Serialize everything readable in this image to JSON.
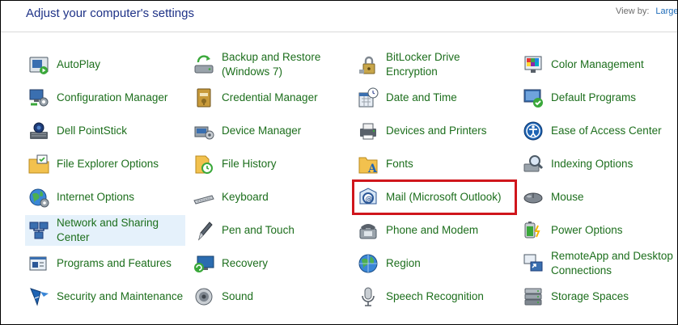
{
  "header": {
    "title": "Adjust your computer's settings",
    "view_by_label": "View by:",
    "view_by_value": "Large i"
  },
  "items": [
    {
      "label": "AutoPlay",
      "icon": "autoplay-icon"
    },
    {
      "label": "Backup and Restore (Windows 7)",
      "icon": "backup-restore-icon"
    },
    {
      "label": "BitLocker Drive Encryption",
      "icon": "bitlocker-icon"
    },
    {
      "label": "Color Management",
      "icon": "color-management-icon"
    },
    {
      "label": "Configuration Manager",
      "icon": "configuration-manager-icon"
    },
    {
      "label": "Credential Manager",
      "icon": "credential-manager-icon"
    },
    {
      "label": "Date and Time",
      "icon": "date-time-icon"
    },
    {
      "label": "Default Programs",
      "icon": "default-programs-icon"
    },
    {
      "label": "Dell PointStick",
      "icon": "dell-pointstick-icon"
    },
    {
      "label": "Device Manager",
      "icon": "device-manager-icon"
    },
    {
      "label": "Devices and Printers",
      "icon": "devices-printers-icon"
    },
    {
      "label": "Ease of Access Center",
      "icon": "ease-of-access-icon"
    },
    {
      "label": "File Explorer Options",
      "icon": "file-explorer-options-icon"
    },
    {
      "label": "File History",
      "icon": "file-history-icon"
    },
    {
      "label": "Fonts",
      "icon": "fonts-icon"
    },
    {
      "label": "Indexing Options",
      "icon": "indexing-options-icon"
    },
    {
      "label": "Internet Options",
      "icon": "internet-options-icon"
    },
    {
      "label": "Keyboard",
      "icon": "keyboard-icon"
    },
    {
      "label": "Mail (Microsoft Outlook)",
      "icon": "mail-outlook-icon"
    },
    {
      "label": "Mouse",
      "icon": "mouse-icon"
    },
    {
      "label": "Network and Sharing Center",
      "icon": "network-sharing-icon"
    },
    {
      "label": "Pen and Touch",
      "icon": "pen-touch-icon"
    },
    {
      "label": "Phone and Modem",
      "icon": "phone-modem-icon"
    },
    {
      "label": "Power Options",
      "icon": "power-options-icon"
    },
    {
      "label": "Programs and Features",
      "icon": "programs-features-icon"
    },
    {
      "label": "Recovery",
      "icon": "recovery-icon"
    },
    {
      "label": "Region",
      "icon": "region-icon"
    },
    {
      "label": "RemoteApp and Desktop Connections",
      "icon": "remoteapp-icon"
    },
    {
      "label": "Security and Maintenance",
      "icon": "security-maintenance-icon"
    },
    {
      "label": "Sound",
      "icon": "sound-icon"
    },
    {
      "label": "Speech Recognition",
      "icon": "speech-recognition-icon"
    },
    {
      "label": "Storage Spaces",
      "icon": "storage-spaces-icon"
    }
  ],
  "state": {
    "hovered_item": "Network and Sharing Center",
    "annotated_item": "Mail (Microsoft Outlook)"
  },
  "colors": {
    "title": "#1e3287",
    "label": "#1c6e1c",
    "hover_bg": "#e5f1fb",
    "annotation_box": "#d0161c"
  }
}
